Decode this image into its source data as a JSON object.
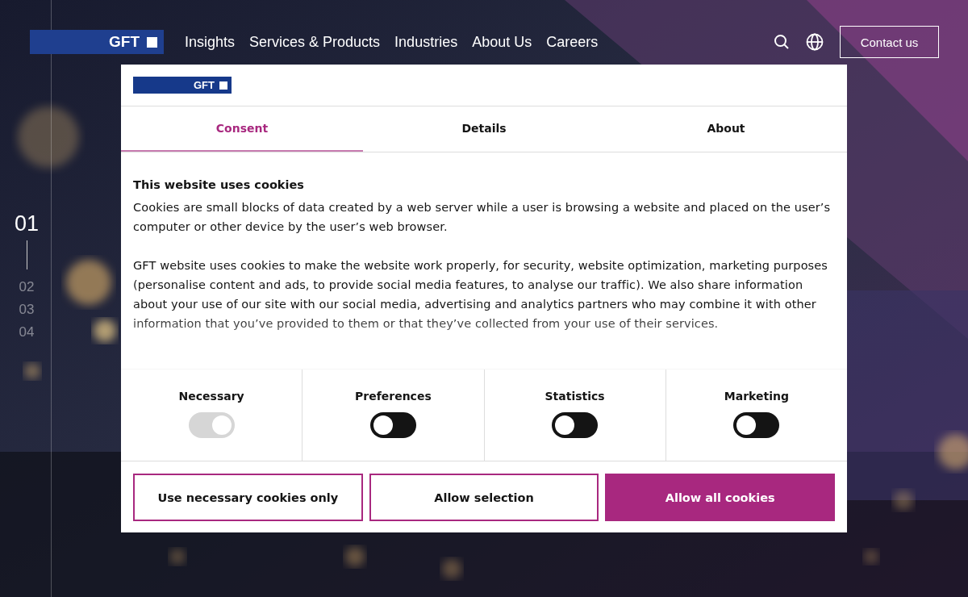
{
  "header": {
    "logo": "GFT",
    "nav": [
      "Insights",
      "Services & Products",
      "Industries",
      "About Us",
      "Careers"
    ],
    "contact_button": "Contact us"
  },
  "slide_pager": [
    {
      "label": "01",
      "selected": true
    },
    {
      "label": "02",
      "selected": false
    },
    {
      "label": "03",
      "selected": false
    },
    {
      "label": "04",
      "selected": false
    }
  ],
  "dialog": {
    "logo": "GFT",
    "tabs": [
      {
        "label": "Consent",
        "selected": true
      },
      {
        "label": "Details",
        "selected": false
      },
      {
        "label": "About",
        "selected": false
      }
    ],
    "heading": "This website uses cookies",
    "paragraphs": [
      "Cookies are small blocks of data created by a web server while a user is browsing a website and placed on the user’s computer or other device by the user’s web browser.",
      "GFT website uses cookies to make the website work properly, for security, website optimization, marketing purposes (personalise content and ads, to provide social media features, to analyse our traffic). We also share information about your use of our site with our social media, advertising and analytics partners who may combine it with other information that you’ve provided to them or that they’ve collected from your use of their services."
    ],
    "categories": [
      {
        "label": "Necessary",
        "checked": true,
        "disabled": true
      },
      {
        "label": "Preferences",
        "checked": false,
        "disabled": false
      },
      {
        "label": "Statistics",
        "checked": false,
        "disabled": false
      },
      {
        "label": "Marketing",
        "checked": false,
        "disabled": false
      }
    ],
    "buttons": [
      {
        "label": "Use necessary cookies only",
        "kind": "outline"
      },
      {
        "label": "Allow selection",
        "kind": "outline"
      },
      {
        "label": "Allow all cookies",
        "kind": "filled"
      }
    ]
  }
}
